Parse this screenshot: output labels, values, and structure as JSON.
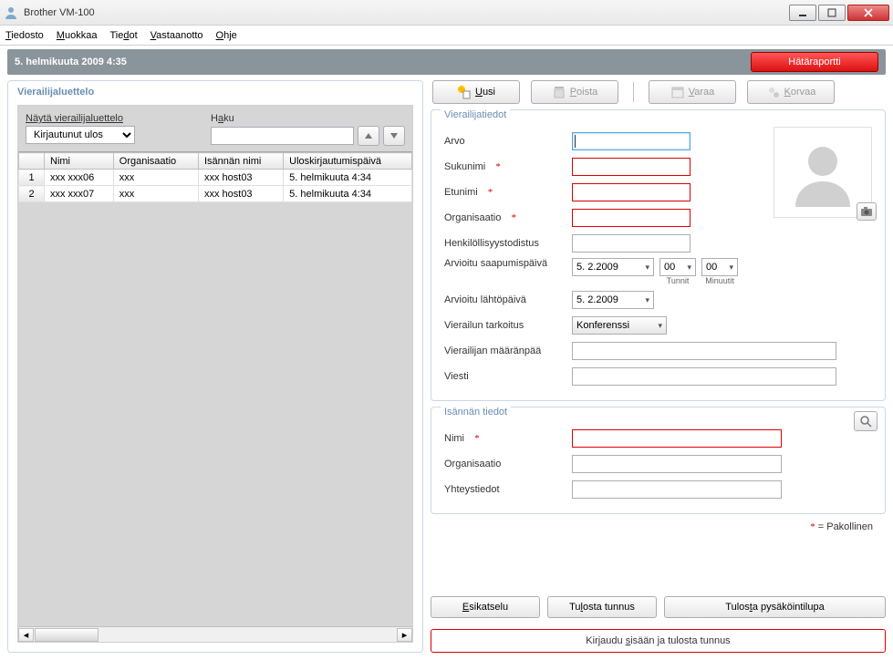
{
  "window": {
    "title": "Brother VM-100"
  },
  "menu": {
    "tiedosto": "Tiedosto",
    "muokkaa": "Muokkaa",
    "tiedot": "Tiedot",
    "vastaanotto": "Vastaanotto",
    "ohje": "Ohje"
  },
  "datestrip": {
    "date": "5. helmikuuta 2009 4:35"
  },
  "emergency": {
    "label": "Hätäraportti"
  },
  "left": {
    "caption": "Vierailijaluettelo",
    "filter_label": "Näytä vierailijaluettelo",
    "filter_value": "Kirjautunut ulos",
    "search_label": "Haku",
    "cols": {
      "nimi": "Nimi",
      "org": "Organisaatio",
      "host": "Isännän nimi",
      "out": "Uloskirjautumispäivä"
    },
    "rows": [
      {
        "n": "1",
        "nimi": "xxx xxx06",
        "org": "xxx",
        "host": "xxx host03",
        "out": "5. helmikuuta 4:34"
      },
      {
        "n": "2",
        "nimi": "xxx xxx07",
        "org": "xxx",
        "host": "xxx host03",
        "out": "5. helmikuuta 4:34"
      }
    ]
  },
  "toolbar": {
    "uusi": "Uusi",
    "poista": "Poista",
    "varaa": "Varaa",
    "korvaa": "Korvaa"
  },
  "visitor": {
    "legend": "Vierailijatiedot",
    "arvo": "Arvo",
    "sukunimi": "Sukunimi",
    "etunimi": "Etunimi",
    "organisaatio": "Organisaatio",
    "henkilo": "Henkilöllisyystodistus",
    "saapumis": "Arvioitu saapumispäivä",
    "lahto": "Arvioitu lähtöpäivä",
    "tarkoitus": "Vierailun tarkoitus",
    "maaranpaa": "Vierailijan määränpää",
    "viesti": "Viesti",
    "date1": "5.  2.2009",
    "date2": "5.  2.2009",
    "hh": "00",
    "mm": "00",
    "tunnit": "Tunnit",
    "minuutit": "Minuutit",
    "purpose_value": "Konferenssi"
  },
  "host": {
    "legend": "Isännän tiedot",
    "nimi": "Nimi",
    "org": "Organisaatio",
    "yhteys": "Yhteystiedot"
  },
  "required_note": "= Pakollinen",
  "bottom": {
    "esikatselu": "Esikatselu",
    "tulosta": "Tulosta tunnus",
    "pysak": "Tulosta pysäköintilupa",
    "kirjaudu": "Kirjaudu sisään ja tulosta tunnus"
  }
}
